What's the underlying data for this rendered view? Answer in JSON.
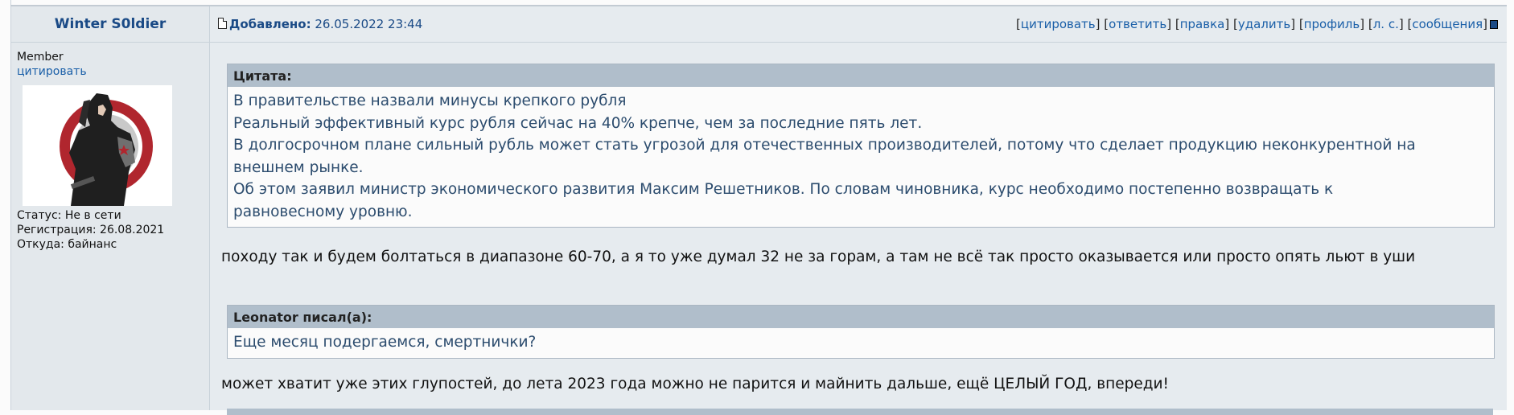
{
  "author": {
    "name": "Winter S0ldier",
    "rank": "Member",
    "quote_link": "цитировать",
    "status": "Статус: Не в сети",
    "registration": "Регистрация: 26.08.2021",
    "from": "Откуда: байнанс"
  },
  "post_header": {
    "added_label": "Добавлено:",
    "added_date": "26.05.2022 23:44",
    "actions": [
      "цитировать",
      "ответить",
      "правка",
      "удалить",
      "профиль",
      "л. с.",
      "сообщения"
    ]
  },
  "quote1": {
    "title": "Цитата:",
    "lines": [
      "В правительстве назвали минусы крепкого рубля",
      "Реальный эффективный курс рубля сейчас на 40% крепче, чем за последние пять лет.",
      "В долгосрочном плане сильный рубль может стать угрозой для отечественных производителей, потому что сделает продукцию неконкурентной на",
      "внешнем рынке.",
      "Об этом заявил министр экономического развития Максим Решетников. По словам чиновника, курс необходимо постепенно возвращать к",
      "равновесному уровню."
    ]
  },
  "reply1": "походу так и будем болтаться в диапазоне 60-70, а я то уже думал 32 не за горам, а там не всё так просто оказывается или просто опять льют в уши",
  "quote2": {
    "title": "Leonator писал(а):",
    "text": "Еще месяц подергаемся, смертнички?"
  },
  "reply2": "может хватит уже этих глупостей, до лета 2023 года можно не парится и майнить дальше, ещё ЦЕЛЫЙ ГОД, впереди!"
}
